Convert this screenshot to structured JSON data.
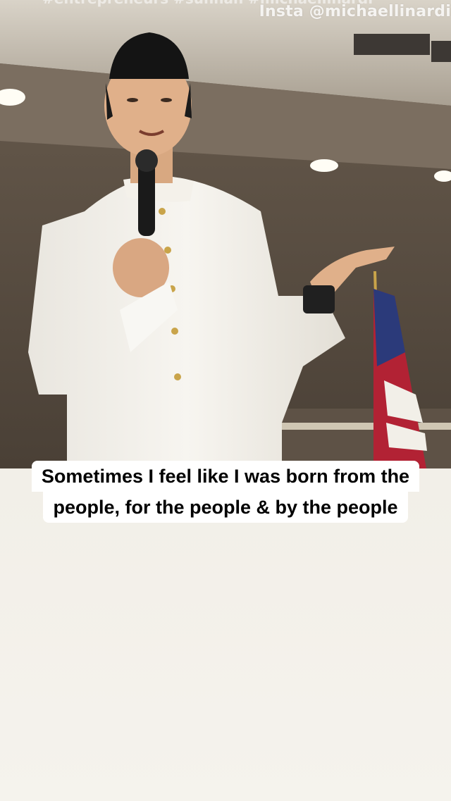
{
  "story": {
    "watermark_handle": "Insta @michaellinardi",
    "watermark_top_partial": "#entrepreneurs #sunnah #michaellinardi",
    "caption_lines": [
      "Sometimes I feel like I was born from the",
      "people, for the people & by the people"
    ]
  },
  "colors": {
    "caption_bg": "#ffffff",
    "caption_text": "#000000",
    "background_top": "#ece8df",
    "background_bottom": "#f5f3ed"
  }
}
